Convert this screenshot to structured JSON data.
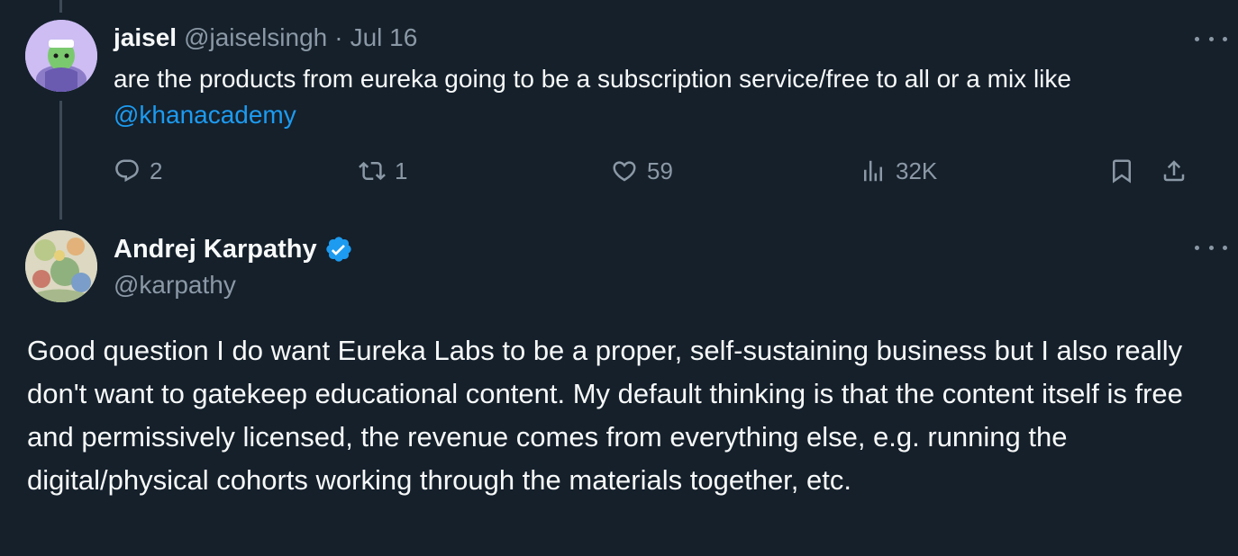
{
  "reply": {
    "author_name": "jaisel",
    "author_handle": "@jaiselsingh",
    "separator": "·",
    "date": "Jul 16",
    "text_before_mention": "are the products from eureka going to be a subscription service/free to all or a mix like ",
    "mention": "@khanacademy",
    "actions": {
      "reply_count": "2",
      "retweet_count": "1",
      "like_count": "59",
      "view_count": "32K"
    }
  },
  "main_tweet": {
    "author_name": "Andrej Karpathy",
    "author_handle": "@karpathy",
    "text": "Good question I do want Eureka Labs to be a proper, self-sustaining business but I also really don't want to gatekeep educational content. My default thinking is that the content itself is free and permissively licensed, the revenue comes from everything else, e.g. running the digital/physical cohorts working through the materials together, etc."
  },
  "icons": {
    "reply": "speech-bubble-icon",
    "retweet": "retweet-icon",
    "like": "heart-icon",
    "views": "bar-chart-icon",
    "bookmark": "bookmark-icon",
    "share": "share-icon",
    "more": "ellipsis-icon",
    "verified": "verified-badge-icon"
  },
  "colors": {
    "background": "#15202b",
    "primary_text": "#f7f9f9",
    "secondary_text": "#8b98a5",
    "accent": "#1d9bf0"
  }
}
